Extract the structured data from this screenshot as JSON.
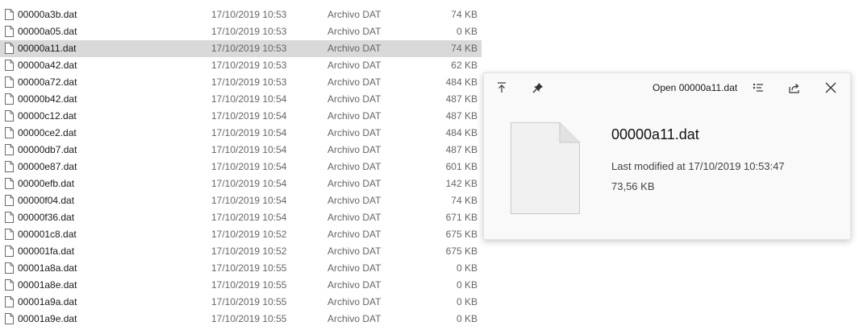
{
  "files": [
    {
      "name": "00000a3b.dat",
      "date": "17/10/2019 10:53",
      "type": "Archivo DAT",
      "size": "74 KB"
    },
    {
      "name": "00000a05.dat",
      "date": "17/10/2019 10:53",
      "type": "Archivo DAT",
      "size": "0 KB"
    },
    {
      "name": "00000a11.dat",
      "date": "17/10/2019 10:53",
      "type": "Archivo DAT",
      "size": "74 KB",
      "selected": true
    },
    {
      "name": "00000a42.dat",
      "date": "17/10/2019 10:53",
      "type": "Archivo DAT",
      "size": "62 KB"
    },
    {
      "name": "00000a72.dat",
      "date": "17/10/2019 10:53",
      "type": "Archivo DAT",
      "size": "484 KB"
    },
    {
      "name": "00000b42.dat",
      "date": "17/10/2019 10:54",
      "type": "Archivo DAT",
      "size": "487 KB"
    },
    {
      "name": "00000c12.dat",
      "date": "17/10/2019 10:54",
      "type": "Archivo DAT",
      "size": "487 KB"
    },
    {
      "name": "00000ce2.dat",
      "date": "17/10/2019 10:54",
      "type": "Archivo DAT",
      "size": "484 KB"
    },
    {
      "name": "00000db7.dat",
      "date": "17/10/2019 10:54",
      "type": "Archivo DAT",
      "size": "487 KB"
    },
    {
      "name": "00000e87.dat",
      "date": "17/10/2019 10:54",
      "type": "Archivo DAT",
      "size": "601 KB"
    },
    {
      "name": "00000efb.dat",
      "date": "17/10/2019 10:54",
      "type": "Archivo DAT",
      "size": "142 KB"
    },
    {
      "name": "00000f04.dat",
      "date": "17/10/2019 10:54",
      "type": "Archivo DAT",
      "size": "74 KB"
    },
    {
      "name": "00000f36.dat",
      "date": "17/10/2019 10:54",
      "type": "Archivo DAT",
      "size": "671 KB"
    },
    {
      "name": "000001c8.dat",
      "date": "17/10/2019 10:52",
      "type": "Archivo DAT",
      "size": "675 KB"
    },
    {
      "name": "000001fa.dat",
      "date": "17/10/2019 10:52",
      "type": "Archivo DAT",
      "size": "675 KB"
    },
    {
      "name": "00001a8a.dat",
      "date": "17/10/2019 10:55",
      "type": "Archivo DAT",
      "size": "0 KB"
    },
    {
      "name": "00001a8e.dat",
      "date": "17/10/2019 10:55",
      "type": "Archivo DAT",
      "size": "0 KB"
    },
    {
      "name": "00001a9a.dat",
      "date": "17/10/2019 10:55",
      "type": "Archivo DAT",
      "size": "0 KB"
    },
    {
      "name": "00001a9e.dat",
      "date": "17/10/2019 10:55",
      "type": "Archivo DAT",
      "size": "0 KB"
    }
  ],
  "preview": {
    "open_label": "Open 00000a11.dat",
    "file_name": "00000a11.dat",
    "modified": "Last modified at 17/10/2019 10:53:47",
    "size": "73,56 KB",
    "toolbar_icons": [
      "move-to-top-icon",
      "pin-icon",
      "list-icon",
      "share-icon",
      "close-icon"
    ]
  },
  "colors": {
    "selected_row": "#d9d9d9",
    "preview_background": "#f9f9f9",
    "secondary_text": "#666666"
  }
}
